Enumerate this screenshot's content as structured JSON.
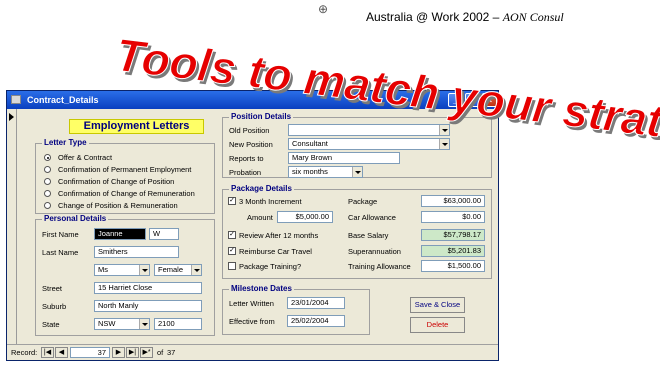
{
  "slide": {
    "header_main": "Australia @ Work 2002 – ",
    "header_italic": "AON Consul",
    "headline": "Tools to match your strategy"
  },
  "window": {
    "title": "Contract_Details",
    "form_title": "Employment Letters"
  },
  "letter_type": {
    "legend": "Letter Type",
    "options": [
      "Offer & Contract",
      "Confirmation of Permanent Employment",
      "Confirmation of Change of Position",
      "Confirmation of Change of Remuneration",
      "Change of Position & Remuneration"
    ],
    "selected_index": 0
  },
  "personal": {
    "legend": "Personal Details",
    "first_name_label": "First Name",
    "first_name": "Joanne",
    "initial": "W",
    "last_name_label": "Last Name",
    "last_name": "Smithers",
    "title": "Ms",
    "gender": "Female",
    "street_label": "Street",
    "street": "15 Harriet Close",
    "suburb_label": "Suburb",
    "suburb": "North Manly",
    "state_label": "State",
    "state": "NSW",
    "postcode": "2100"
  },
  "position": {
    "legend": "Position Details",
    "old_position_label": "Old Position",
    "old_position": "",
    "new_position_label": "New Position",
    "new_position": "Consultant",
    "reports_to_label": "Reports to",
    "reports_to": "Mary Brown",
    "probation_label": "Probation",
    "probation": "six months"
  },
  "package": {
    "legend": "Package Details",
    "increment_label": "3 Month Increment",
    "increment_checked": true,
    "amount_label": "Amount",
    "amount": "$5,000.00",
    "review_label": "Review After 12 months",
    "review_checked": true,
    "reimburse_label": "Reimburse Car Travel",
    "reimburse_checked": true,
    "training_label": "Package Training?",
    "training_checked": false,
    "package_label": "Package",
    "package": "$63,000.00",
    "car_label": "Car Allowance",
    "car": "$0.00",
    "base_label": "Base Salary",
    "base": "$57,798.17",
    "super_label": "Superannuation",
    "super": "$5,201.83",
    "training_allow_label": "Training Allowance",
    "training_allow": "$1,500.00"
  },
  "milestones": {
    "legend": "Milestone Dates",
    "letter_label": "Letter Written",
    "letter": "23/01/2004",
    "effective_label": "Effective from",
    "effective": "25/02/2004"
  },
  "buttons": {
    "save": "Save & Close",
    "delete": "Delete"
  },
  "navigation": {
    "record_label": "Record:",
    "first": "|◀",
    "prev": "◀",
    "current": "37",
    "next": "▶",
    "last": "▶|",
    "new": "▶*",
    "of_label": "of",
    "total": "37"
  },
  "colors": {
    "legend": "#000080",
    "headline": "#e60000",
    "badge": "#ffff66",
    "shaded_field": "#cde8c8",
    "delete_text": "#cc0000"
  }
}
